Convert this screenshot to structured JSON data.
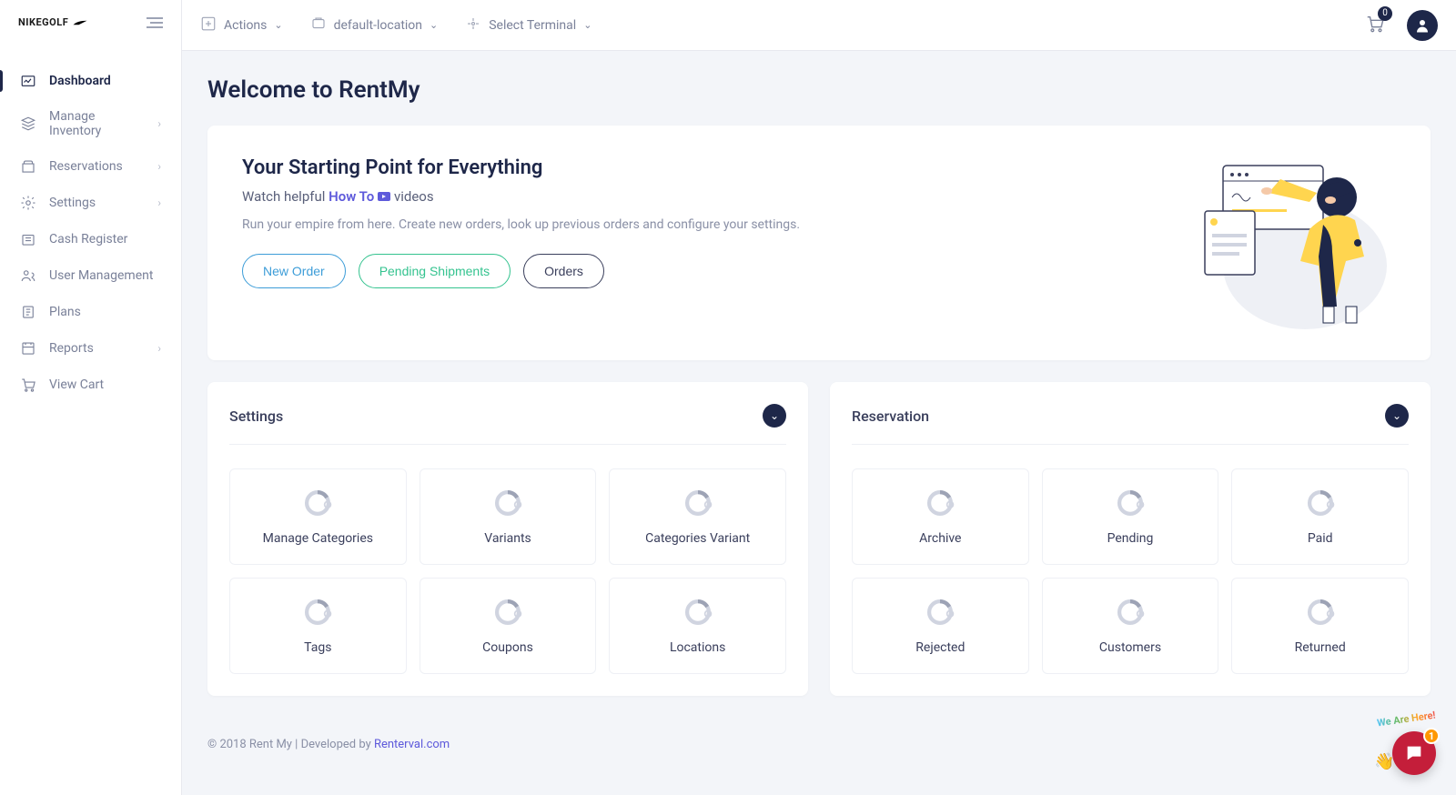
{
  "brand": "NIKEGOLF",
  "topbar": {
    "actions": "Actions",
    "location": "default-location",
    "terminal": "Select Terminal",
    "cart_count": "0"
  },
  "sidebar": [
    {
      "label": "Dashboard",
      "active": true,
      "expand": false
    },
    {
      "label": "Manage Inventory",
      "expand": true
    },
    {
      "label": "Reservations",
      "expand": true
    },
    {
      "label": "Settings",
      "expand": true
    },
    {
      "label": "Cash Register"
    },
    {
      "label": "User Management"
    },
    {
      "label": "Plans"
    },
    {
      "label": "Reports",
      "expand": true
    },
    {
      "label": "View Cart"
    }
  ],
  "page_title": "Welcome to RentMy",
  "hero": {
    "title": "Your Starting Point for Everything",
    "sub_pre": "Watch helpful",
    "sub_link": "How To",
    "sub_post": "videos",
    "desc": "Run your empire from here. Create new orders, look up previous orders and configure your settings.",
    "btn1": "New Order",
    "btn2": "Pending Shipments",
    "btn3": "Orders"
  },
  "panel_settings": {
    "title": "Settings",
    "tiles": [
      "Manage Categories",
      "Variants",
      "Categories Variant",
      "Tags",
      "Coupons",
      "Locations"
    ]
  },
  "panel_reservation": {
    "title": "Reservation",
    "tiles": [
      "Archive",
      "Pending",
      "Paid",
      "Rejected",
      "Customers",
      "Returned"
    ]
  },
  "footer": {
    "text": "© 2018 Rent My | Developed by ",
    "link": "Renterval.com"
  },
  "chat": {
    "text": "We Are Here!",
    "badge": "1"
  }
}
